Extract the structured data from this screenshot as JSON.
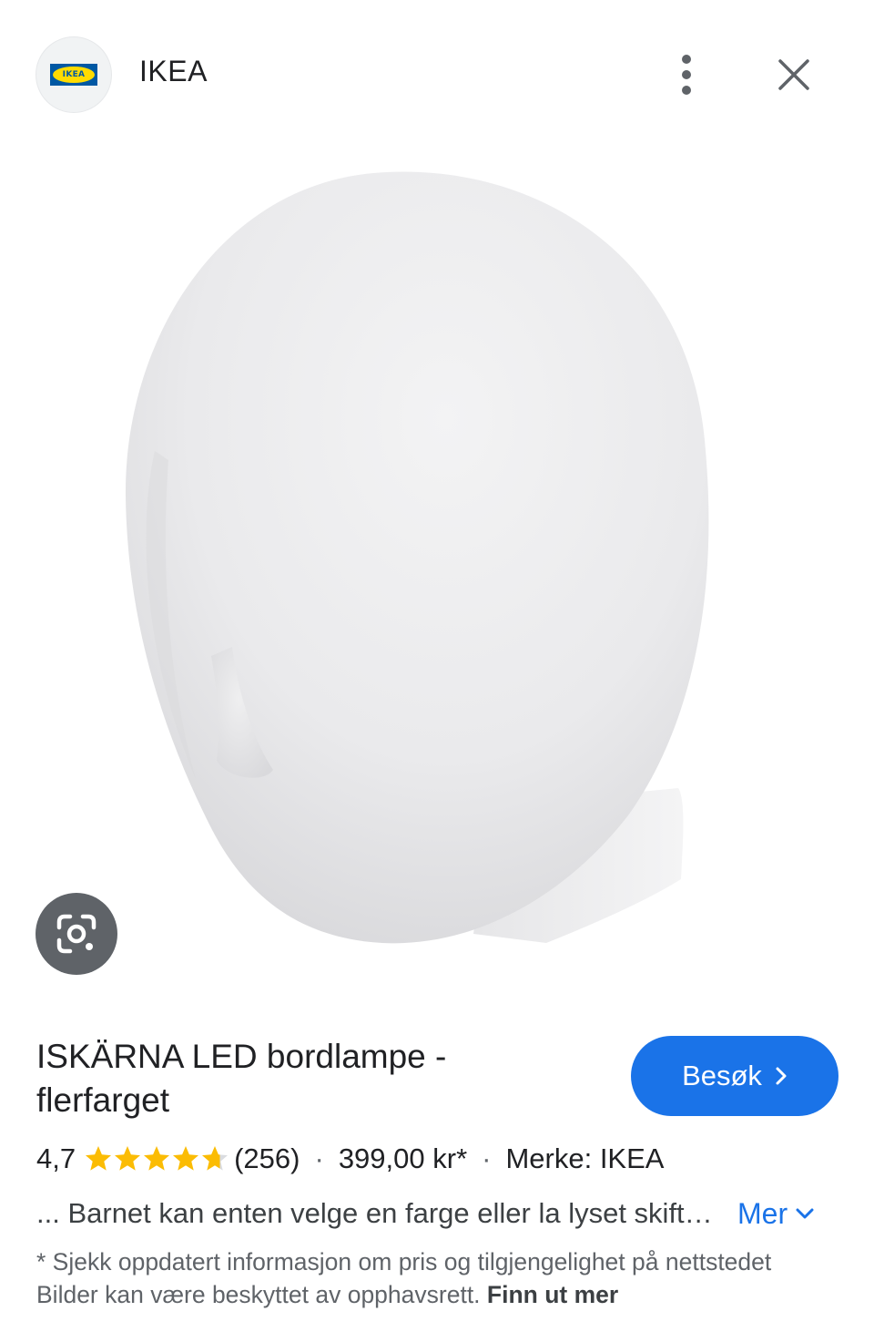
{
  "header": {
    "logo_text": "IKEA",
    "site_name": "IKEA",
    "more_icon": "more-vert-icon",
    "close_icon": "close-icon"
  },
  "image": {
    "lens_icon": "google-lens-icon"
  },
  "product": {
    "title": "ISKÄRNA LED bordlampe - flerfarget",
    "visit_label": "Besøk",
    "rating": "4,7",
    "rating_value": 4.7,
    "rating_max": 5,
    "review_count": "(256)",
    "separator": "·",
    "price": "399,00 kr*",
    "brand": "Merke: IKEA",
    "description": "... Barnet kan enten velge en farge eller la lyset skifte farge",
    "more_label": "Mer",
    "disclaimer": "* Sjekk oppdatert informasjon om pris og tilgjengelighet på nettstedet Bilder kan være beskyttet av opphavsrett.",
    "find_more": "Finn ut mer"
  },
  "colors": {
    "accent": "#1a73e8",
    "star": "#fbbc04",
    "text": "#202124",
    "muted": "#5f6368"
  }
}
